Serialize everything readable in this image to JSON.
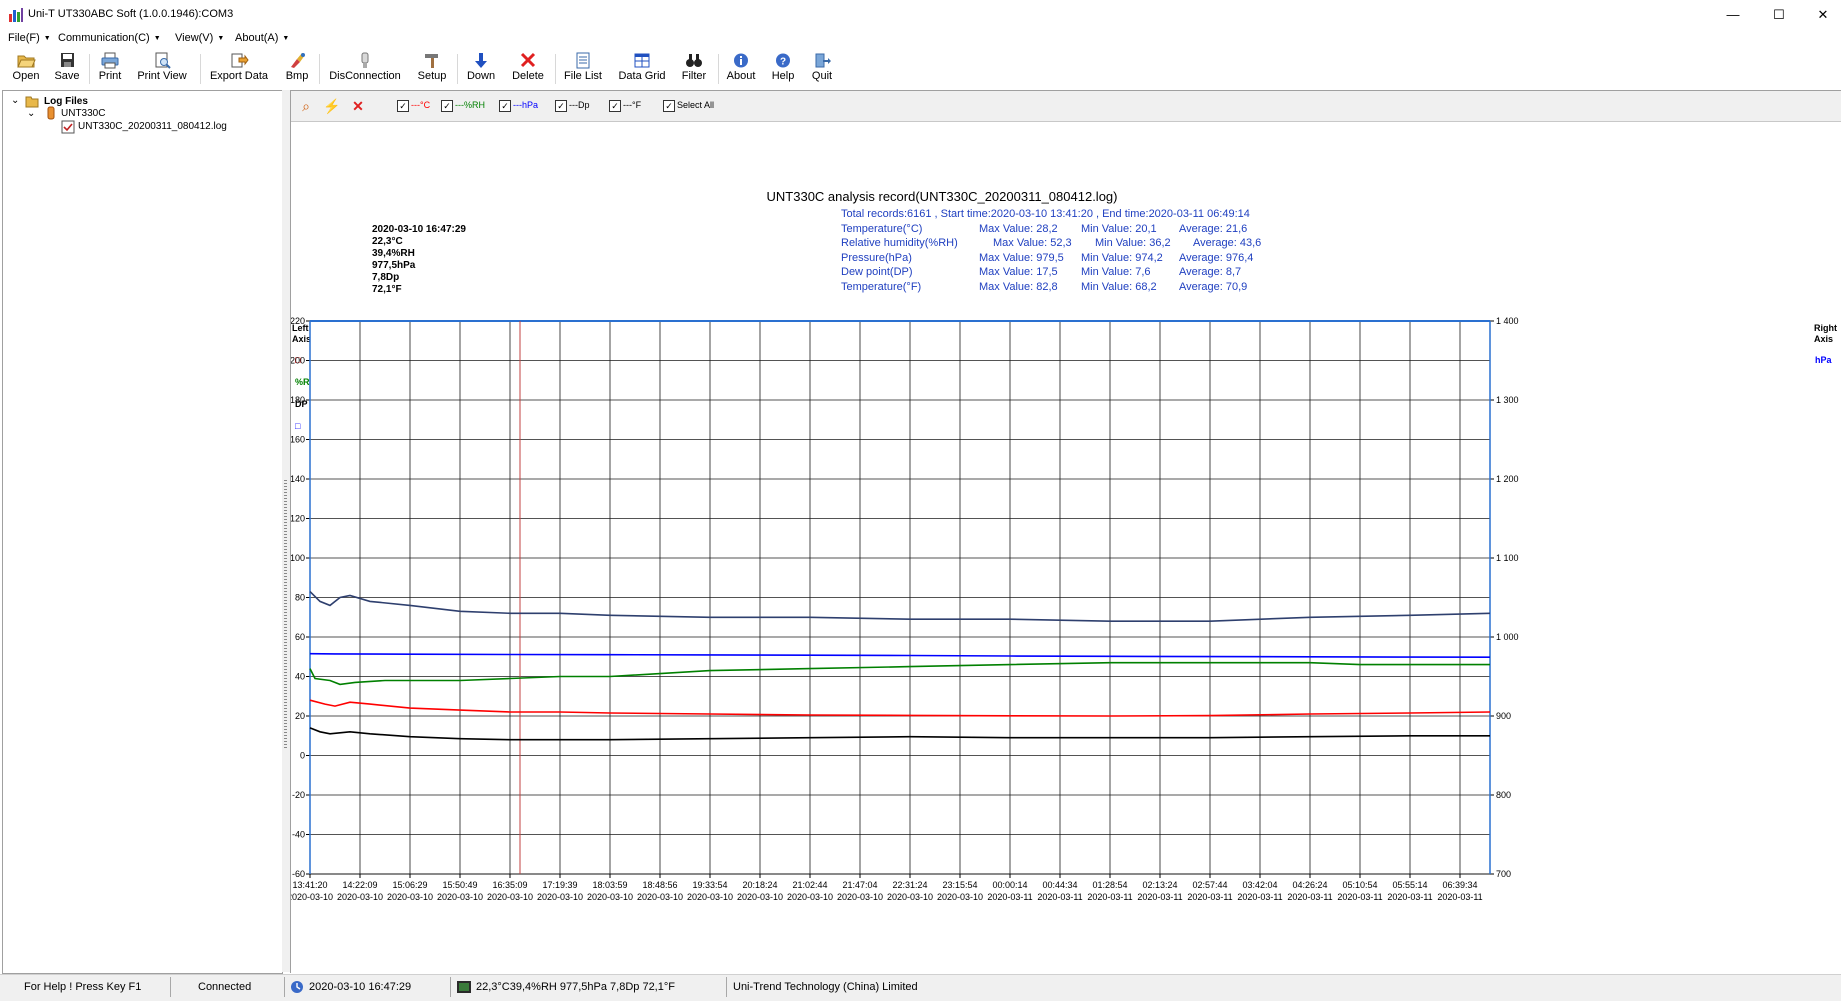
{
  "window": {
    "title": "Uni-T UT330ABC Soft (1.0.0.1946):COM3",
    "minimize": "—",
    "maximize": "☐",
    "close": "✕"
  },
  "menu": [
    {
      "label": "File(F)"
    },
    {
      "label": "Communication(C)"
    },
    {
      "label": "View(V)"
    },
    {
      "label": "About(A)"
    }
  ],
  "toolbar": [
    {
      "label": "Open",
      "icon": "folder-open-icon"
    },
    {
      "label": "Save",
      "icon": "floppy-disk-icon"
    },
    {
      "label": "Print",
      "icon": "printer-icon"
    },
    {
      "label": "Print View",
      "icon": "print-preview-icon"
    },
    {
      "label": "Export Data",
      "icon": "export-data-icon"
    },
    {
      "label": "Bmp",
      "icon": "paint-bmp-icon"
    },
    {
      "label": "DisConnection",
      "icon": "disconnect-icon"
    },
    {
      "label": "Setup",
      "icon": "setup-hammer-icon"
    },
    {
      "label": "Down",
      "icon": "down-arrow-icon"
    },
    {
      "label": "Delete",
      "icon": "delete-x-icon"
    },
    {
      "label": "File List",
      "icon": "file-list-icon"
    },
    {
      "label": "Data Grid",
      "icon": "data-grid-icon"
    },
    {
      "label": "Filter",
      "icon": "binoculars-icon"
    },
    {
      "label": "About",
      "icon": "info-icon"
    },
    {
      "label": "Help",
      "icon": "help-question-icon"
    },
    {
      "label": "Quit",
      "icon": "quit-icon"
    }
  ],
  "tree": {
    "root": "Log Files",
    "device": "UNT330C",
    "file": "UNT330C_20200311_080412.log"
  },
  "chart_toolbar": {
    "checks": [
      {
        "label": "---°C",
        "color": "#ff0000",
        "checked": true
      },
      {
        "label": "---%RH",
        "color": "#008000",
        "checked": true
      },
      {
        "label": "---hPa",
        "color": "#0000ff",
        "checked": true
      },
      {
        "label": "---Dp",
        "color": "#000000",
        "checked": true
      },
      {
        "label": "---°F",
        "color": "#000000",
        "checked": true
      },
      {
        "label": "Select All",
        "color": "#000000",
        "checked": true
      }
    ]
  },
  "chart_info": {
    "title": "UNT330C analysis record(UNT330C_20200311_080412.log)",
    "summary": "Total records:6161 ,  Start time:2020-03-10 13:41:20 ,  End time:2020-03-11 06:49:14",
    "stats": [
      {
        "name": "Temperature(°C)",
        "max": "Max Value:  28,2",
        "min": "Min Value:  20,1",
        "avg": "Average:  21,6"
      },
      {
        "name": "Relative humidity(%RH)",
        "max": "Max Value:  52,3",
        "min": "Min Value:  36,2",
        "avg": "Average:  43,6"
      },
      {
        "name": "Pressure(hPa)",
        "max": "Max Value:  979,5",
        "min": "Min Value:  974,2",
        "avg": "Average:  976,4"
      },
      {
        "name": "Dew point(DP)",
        "max": "Max Value:  17,5",
        "min": "Min Value:  7,6",
        "avg": "Average:  8,7"
      },
      {
        "name": "Temperature(°F)",
        "max": "Max Value:  82,8",
        "min": "Min Value:  68,2",
        "avg": "Average:  70,9"
      }
    ],
    "cursor": [
      "2020-03-10 16:47:29",
      "22,3°C",
      "39,4%RH",
      "977,5hPa",
      "7,8Dp",
      "72,1°F"
    ],
    "left_axis_title": [
      "Left",
      "Axis"
    ],
    "left_axis_legend": [
      {
        "label": "□",
        "color": "#ff0000"
      },
      {
        "label": "%RH",
        "color": "#008000"
      },
      {
        "label": "DP",
        "color": "#000000"
      },
      {
        "label": "□",
        "color": "#0000ff"
      }
    ],
    "right_axis_title": [
      "Right",
      "Axis"
    ],
    "right_axis_legend": {
      "label": "hPa",
      "color": "#0000ff"
    }
  },
  "chart_data": {
    "type": "line",
    "left_axis": {
      "ylim": [
        -60,
        220
      ],
      "ticks": [
        220,
        200,
        180,
        160,
        140,
        120,
        100,
        80,
        60,
        40,
        20,
        0,
        -20,
        -40,
        -60
      ]
    },
    "right_axis": {
      "ylim": [
        700,
        1400
      ],
      "ticks": [
        "1 400",
        "1 300",
        "1 200",
        "1 100",
        "1 000",
        "900",
        "800",
        "700"
      ]
    },
    "x_times": [
      "13:41:20",
      "14:22:09",
      "15:06:29",
      "15:50:49",
      "16:35:09",
      "17:19:39",
      "18:03:59",
      "18:48:56",
      "19:33:54",
      "20:18:24",
      "21:02:44",
      "21:47:04",
      "22:31:24",
      "23:15:54",
      "00:00:14",
      "00:44:34",
      "01:28:54",
      "02:13:24",
      "02:57:44",
      "03:42:04",
      "04:26:24",
      "05:10:54",
      "05:55:14",
      "06:39:34"
    ],
    "x_dates": [
      "2020-03-10",
      "2020-03-10",
      "2020-03-10",
      "2020-03-10",
      "2020-03-10",
      "2020-03-10",
      "2020-03-10",
      "2020-03-10",
      "2020-03-10",
      "2020-03-10",
      "2020-03-10",
      "2020-03-10",
      "2020-03-10",
      "2020-03-10",
      "2020-03-11",
      "2020-03-11",
      "2020-03-11",
      "2020-03-11",
      "2020-03-11",
      "2020-03-11",
      "2020-03-11",
      "2020-03-11",
      "2020-03-11",
      "2020-03-11"
    ],
    "x_range": [
      0,
      23.6
    ],
    "cursor_x": 4.2,
    "series": [
      {
        "key": "F",
        "axis": "left",
        "color": "#2e3f6e",
        "points": [
          [
            0,
            83
          ],
          [
            0.2,
            78
          ],
          [
            0.4,
            76
          ],
          [
            0.6,
            80
          ],
          [
            0.8,
            81
          ],
          [
            1.2,
            78
          ],
          [
            2,
            76
          ],
          [
            3,
            73
          ],
          [
            4,
            72
          ],
          [
            5,
            72
          ],
          [
            6,
            71
          ],
          [
            8,
            70
          ],
          [
            10,
            70
          ],
          [
            12,
            69
          ],
          [
            14,
            69
          ],
          [
            16,
            68
          ],
          [
            18,
            68
          ],
          [
            20,
            70
          ],
          [
            22,
            71
          ],
          [
            23.6,
            72
          ]
        ]
      },
      {
        "key": "hPa",
        "axis": "right",
        "color": "#0000ff",
        "points": [
          [
            0,
            978.8
          ],
          [
            0.5,
            978.6
          ],
          [
            2,
            978.2
          ],
          [
            4,
            977.8
          ],
          [
            6,
            977.6
          ],
          [
            8,
            977.3
          ],
          [
            10,
            977
          ],
          [
            12,
            976.6
          ],
          [
            14,
            976
          ],
          [
            16,
            975.6
          ],
          [
            18,
            975.2
          ],
          [
            20,
            975
          ],
          [
            22,
            974.6
          ],
          [
            23.6,
            974.4
          ]
        ]
      },
      {
        "key": "RH",
        "axis": "left",
        "color": "#008000",
        "points": [
          [
            0,
            44
          ],
          [
            0.1,
            39
          ],
          [
            0.4,
            38
          ],
          [
            0.6,
            36
          ],
          [
            0.9,
            37
          ],
          [
            1.5,
            38
          ],
          [
            3,
            38
          ],
          [
            4,
            39
          ],
          [
            5,
            40
          ],
          [
            6,
            40
          ],
          [
            8,
            43
          ],
          [
            10,
            44
          ],
          [
            12,
            45
          ],
          [
            14,
            46
          ],
          [
            16,
            47
          ],
          [
            18,
            47
          ],
          [
            20,
            47
          ],
          [
            21,
            46
          ],
          [
            23.6,
            46
          ]
        ]
      },
      {
        "key": "C",
        "axis": "left",
        "color": "#ff0000",
        "points": [
          [
            0,
            28
          ],
          [
            0.3,
            26
          ],
          [
            0.5,
            25
          ],
          [
            0.8,
            27
          ],
          [
            1.2,
            26
          ],
          [
            2,
            24
          ],
          [
            3,
            23
          ],
          [
            4,
            22
          ],
          [
            5,
            22
          ],
          [
            6,
            21.5
          ],
          [
            8,
            21
          ],
          [
            10,
            20.5
          ],
          [
            12,
            20.3
          ],
          [
            14,
            20.1
          ],
          [
            16,
            20
          ],
          [
            18,
            20.2
          ],
          [
            20,
            21
          ],
          [
            22,
            21.5
          ],
          [
            23.6,
            22
          ]
        ]
      },
      {
        "key": "Dp",
        "axis": "left",
        "color": "#000000",
        "points": [
          [
            0,
            14
          ],
          [
            0.2,
            12
          ],
          [
            0.4,
            11
          ],
          [
            0.8,
            12
          ],
          [
            1.2,
            11
          ],
          [
            2,
            9.5
          ],
          [
            3,
            8.5
          ],
          [
            4,
            8
          ],
          [
            6,
            8
          ],
          [
            8,
            8.5
          ],
          [
            10,
            9
          ],
          [
            12,
            9.5
          ],
          [
            14,
            9
          ],
          [
            16,
            9
          ],
          [
            18,
            9
          ],
          [
            20,
            9.5
          ],
          [
            22,
            10
          ],
          [
            23.6,
            10
          ]
        ]
      }
    ]
  },
  "statusbar": {
    "help": "For Help ! Press Key F1",
    "connection": "Connected",
    "time": "2020-03-10 16:47:29",
    "reading": "22,3°C39,4%RH  977,5hPa 7,8Dp  72,1°F",
    "company": "Uni-Trend Technology (China) Limited"
  }
}
